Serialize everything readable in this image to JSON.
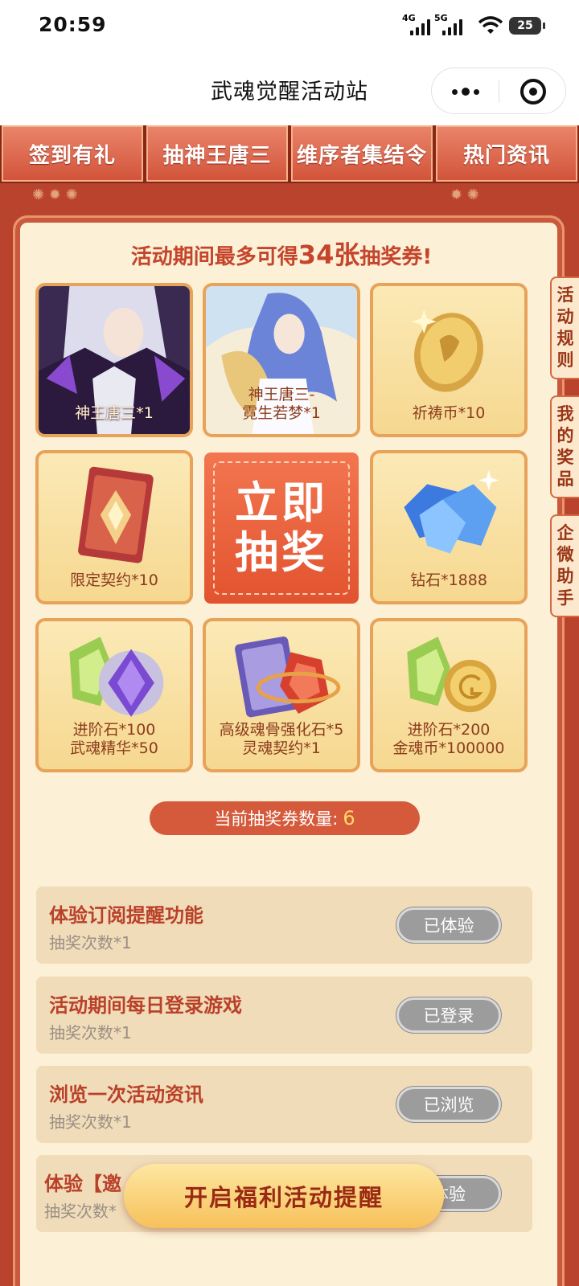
{
  "status_bar": {
    "time": "20:59",
    "net1": "4G",
    "net2": "5G",
    "battery": "25"
  },
  "title_bar": {
    "title": "武魂觉醒活动站"
  },
  "nav_tabs": [
    "签到有礼",
    "抽神王唐三",
    "维序者集结令",
    "热门资讯"
  ],
  "headline": {
    "prefix": "活动期间最多可得",
    "number": "34张",
    "suffix": "抽奖券!"
  },
  "prizes": [
    {
      "label": "神王唐三*1",
      "icon": "character-portrait"
    },
    {
      "label": "神王唐三-\n霓生若梦*1",
      "icon": "character-skin-portrait"
    },
    {
      "label": "祈祷币*10",
      "icon": "gold-coin-icon"
    },
    {
      "label": "限定契约*10",
      "icon": "contract-card-icon"
    },
    {
      "label": "钻石*1888",
      "icon": "diamond-icon"
    },
    {
      "label": "进阶石*100\n武魂精华*50",
      "icon": "gem-icon"
    },
    {
      "label": "高级魂骨强化石*5\n灵魂契约*1",
      "icon": "card-crystal-icon"
    },
    {
      "label": "进阶石*200\n金魂币*100000",
      "icon": "gem-coin-icon"
    }
  ],
  "draw_button": {
    "line1": "立即",
    "line2": "抽奖"
  },
  "side_tabs": [
    "活动规则",
    "我的奖品",
    "企微助手"
  ],
  "ticket": {
    "label": "当前抽奖券数量:",
    "count": "6"
  },
  "tasks": [
    {
      "title": "体验订阅提醒功能",
      "sub": "抽奖次数*1",
      "button": "已体验"
    },
    {
      "title": "活动期间每日登录游戏",
      "sub": "抽奖次数*1",
      "button": "已登录"
    },
    {
      "title": "浏览一次活动资讯",
      "sub": "抽奖次数*1",
      "button": "已浏览"
    },
    {
      "title": "体验【邀",
      "sub": "抽奖次数*",
      "button": "体验"
    }
  ],
  "float_cta": {
    "label": "开启福利活动提醒"
  },
  "colors": {
    "primary_red": "#b9432c",
    "card_bg": "#fcf0d6",
    "accent_orange": "#e2532f",
    "gold": "#f7c15a"
  }
}
